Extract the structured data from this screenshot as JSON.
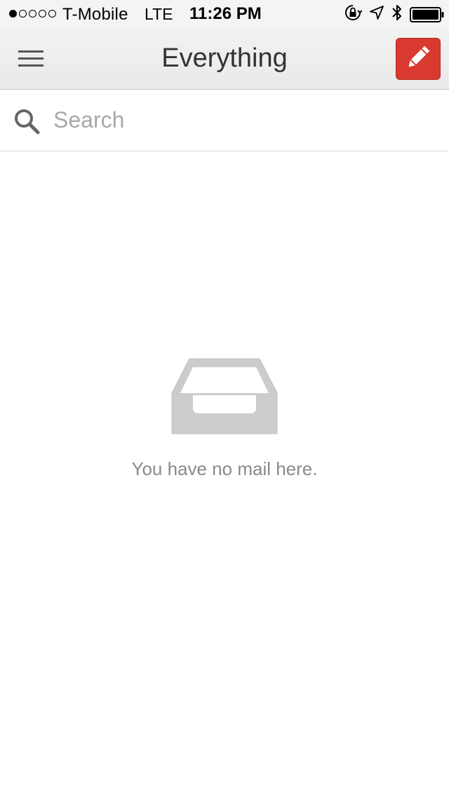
{
  "status_bar": {
    "carrier": "T-Mobile",
    "network": "LTE",
    "time": "11:26 PM",
    "signal_bars_filled": 1,
    "signal_bars_total": 5,
    "battery_level": 1.0,
    "icons": [
      "orientation-lock-icon",
      "location-arrow-icon",
      "bluetooth-icon",
      "battery-icon"
    ]
  },
  "navbar": {
    "title": "Everything",
    "menu_icon": "hamburger-menu-icon",
    "compose_icon": "pencil-icon",
    "compose_color": "#d83a2f"
  },
  "search": {
    "placeholder": "Search",
    "value": "",
    "icon": "search-icon"
  },
  "empty_state": {
    "icon": "inbox-tray-icon",
    "message": "You have no mail here."
  }
}
